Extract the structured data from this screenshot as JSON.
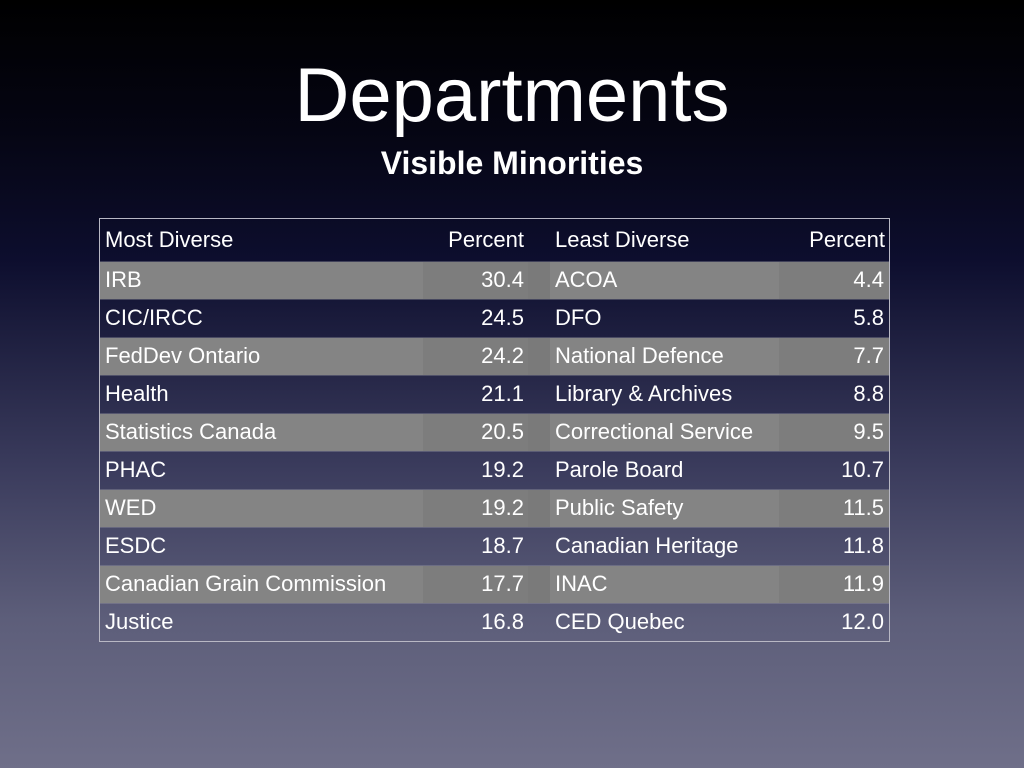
{
  "slide": {
    "title": "Departments",
    "subtitle": "Visible Minorities"
  },
  "table": {
    "headers": {
      "most": "Most Diverse",
      "most_pct": "Percent",
      "least": "Least Diverse",
      "least_pct": "Percent"
    },
    "rows": [
      {
        "most": "IRB",
        "most_pct": "30.4",
        "least": "ACOA",
        "least_pct": "4.4"
      },
      {
        "most": "CIC/IRCC",
        "most_pct": "24.5",
        "least": "DFO",
        "least_pct": "5.8"
      },
      {
        "most": "FedDev Ontario",
        "most_pct": "24.2",
        "least": "National Defence",
        "least_pct": "7.7"
      },
      {
        "most": "Health",
        "most_pct": "21.1",
        "least": "Library & Archives",
        "least_pct": "8.8"
      },
      {
        "most": "Statistics Canada",
        "most_pct": "20.5",
        "least": "Correctional Service",
        "least_pct": "9.5"
      },
      {
        "most": "PHAC",
        "most_pct": "19.2",
        "least": "Parole Board",
        "least_pct": "10.7"
      },
      {
        "most": "WED",
        "most_pct": "19.2",
        "least": "Public Safety",
        "least_pct": "11.5"
      },
      {
        "most": "ESDC",
        "most_pct": "18.7",
        "least": "Canadian Heritage",
        "least_pct": "11.8"
      },
      {
        "most": "Canadian Grain Commission",
        "most_pct": "17.7",
        "least": "INAC",
        "least_pct": "11.9"
      },
      {
        "most": "Justice",
        "most_pct": "16.8",
        "least": "CED Quebec",
        "least_pct": "12.0"
      }
    ]
  }
}
